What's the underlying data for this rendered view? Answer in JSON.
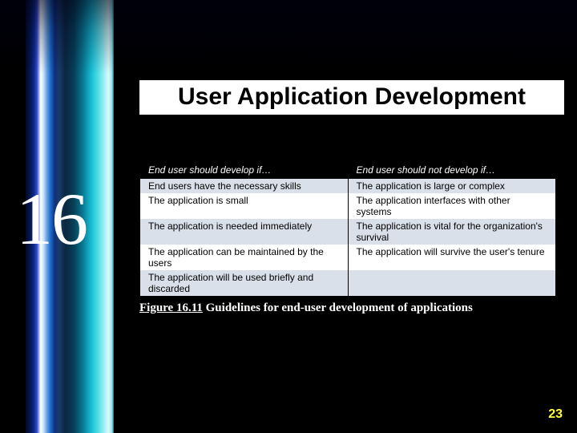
{
  "chapter_number": "16",
  "title": "User Application Development",
  "table": {
    "headers": {
      "left": "End user should develop if…",
      "right": "End user should not develop if…"
    },
    "rows": [
      {
        "left": "End users have the necessary skills",
        "right": "The application is large or complex"
      },
      {
        "left": "The application is small",
        "right": "The application interfaces with other systems"
      },
      {
        "left": "The application is needed immediately",
        "right": "The application is vital for the organization's survival"
      },
      {
        "left": "The application can be maintained by the users",
        "right": "The application will survive the user's tenure"
      },
      {
        "left": "The application will be used briefly and discarded",
        "right": ""
      }
    ]
  },
  "caption": {
    "figref": "Figure 16.11",
    "text": " Guidelines for end-user development of applications"
  },
  "page_number": "23"
}
